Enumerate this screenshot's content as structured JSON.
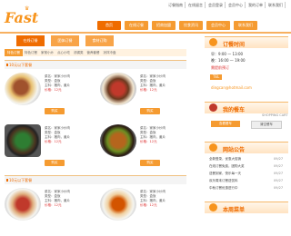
{
  "brand": {
    "logo": "Fast"
  },
  "top_links": [
    "订餐指南",
    "在线留言",
    "会员登录",
    "会员中心",
    "我的订单",
    "联系我们"
  ],
  "nav": [
    "首页",
    "在线订餐",
    "招商加盟",
    "饮食资讯",
    "会员中心",
    "联系我们"
  ],
  "subtabs": [
    "在线订餐",
    "团体订餐",
    "食材订购"
  ],
  "categories": {
    "current": "特色订餐",
    "items": [
      "特色订餐",
      "家常小炒",
      "点心小吃",
      "汤锅类",
      "营养套餐",
      "凉拌冷盘"
    ]
  },
  "sections": [
    "10元以下套餐",
    "10元以下套餐"
  ],
  "dishes": [
    {
      "name": "菜名：家家小炒肉",
      "type": "类型：盒饭",
      "ingredients": "主料：猪肉，姜片",
      "price": "价格：12元",
      "buy": "购买"
    },
    {
      "name": "菜名：家家小炒肉",
      "type": "类型：盒饭",
      "ingredients": "主料：猪肉，姜片",
      "price": "价格：12元",
      "buy": "购买"
    },
    {
      "name": "菜名：家家小炒肉",
      "type": "类型：盒饭",
      "ingredients": "主料：猪肉，姜片",
      "price": "价格：12元",
      "buy": "购买"
    },
    {
      "name": "菜名：家家小炒肉",
      "type": "类型：盒饭",
      "ingredients": "主料：猪肉，姜片",
      "price": "价格：12元",
      "buy": "购买"
    },
    {
      "name": "菜名：家家小炒肉",
      "type": "类型：盒饭",
      "ingredients": "主料：猪肉，姜片",
      "price": "价格：12元",
      "buy": "购买"
    },
    {
      "name": "菜名：家家小炒肉",
      "type": "类型：盒饭",
      "ingredients": "主料：猪肉，姜片",
      "price": "价格：12元",
      "buy": "购买"
    }
  ],
  "sidebar": {
    "hours_title": "订餐时间",
    "hours": [
      "早：9:00 — 13:00",
      "晚：16:00 — 19:00"
    ],
    "hours_note": "需提前预订",
    "phone_badge": "TEL",
    "email": "dingcan@hotmail.com",
    "cart_title": "我的餐车",
    "cart_sub": "SHOPPING CART",
    "cart_view": "查看餐车",
    "cart_clear": "清空餐车",
    "notice_title": "网站公告",
    "notices": [
      {
        "text": "全新登录，优惠大促销",
        "date": "09/27"
      },
      {
        "text": "在线订餐免费，团购大奖",
        "date": "09/27"
      },
      {
        "text": "送餐到家，快乐每一天",
        "date": "09/27"
      },
      {
        "text": "欢乐周末订餐送饮料",
        "date": "09/27"
      },
      {
        "text": "中秋订餐优惠进行中",
        "date": "09/27"
      }
    ],
    "menu_title": "本周菜单"
  },
  "colors": {
    "brand_orange": "#f7941d",
    "nav_orange": "#f59b31",
    "accent_red": "#d33333"
  }
}
